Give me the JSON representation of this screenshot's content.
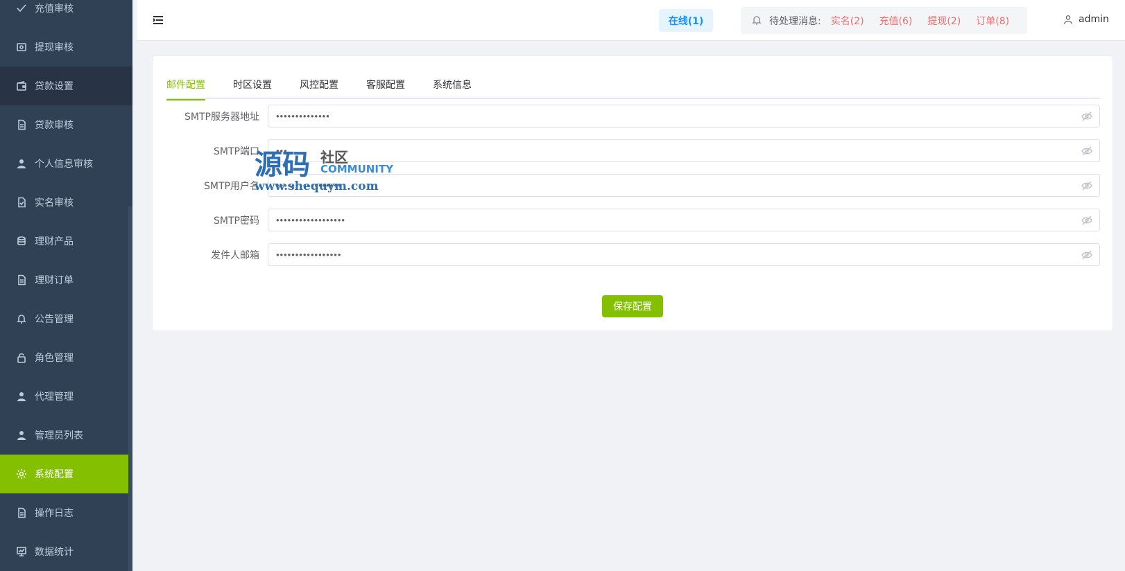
{
  "sidebar": {
    "items": [
      {
        "label": "充值审核",
        "icon": "check-icon"
      },
      {
        "label": "提现审核",
        "icon": "image-icon"
      },
      {
        "label": "贷款设置",
        "icon": "wallet-icon"
      },
      {
        "label": "贷款审核",
        "icon": "document-icon"
      },
      {
        "label": "个人信息审核",
        "icon": "user-icon"
      },
      {
        "label": "实名审核",
        "icon": "document-check-icon"
      },
      {
        "label": "理财产品",
        "icon": "coins-icon"
      },
      {
        "label": "理财订单",
        "icon": "document-icon"
      },
      {
        "label": "公告管理",
        "icon": "bell-icon"
      },
      {
        "label": "角色管理",
        "icon": "lock-icon"
      },
      {
        "label": "代理管理",
        "icon": "user-icon"
      },
      {
        "label": "管理员列表",
        "icon": "user-icon"
      },
      {
        "label": "系统配置",
        "icon": "gear-icon"
      },
      {
        "label": "操作日志",
        "icon": "document-icon"
      },
      {
        "label": "数据统计",
        "icon": "chart-icon"
      }
    ],
    "active_index": 12
  },
  "header": {
    "online": "在线(1)",
    "pending_label": "待处理消息:",
    "pending": [
      {
        "label": "实名(2)"
      },
      {
        "label": "充值(6)"
      },
      {
        "label": "提现(2)"
      },
      {
        "label": "订单(8)"
      }
    ],
    "username": "admin"
  },
  "tabs": [
    {
      "label": "邮件配置"
    },
    {
      "label": "时区设置"
    },
    {
      "label": "风控配置"
    },
    {
      "label": "客服配置"
    },
    {
      "label": "系统信息"
    }
  ],
  "form": {
    "fields": [
      {
        "label": "SMTP服务器地址",
        "value": "••••••••••••••"
      },
      {
        "label": "SMTP端口",
        "value": "•••"
      },
      {
        "label": "SMTP用户名",
        "value": "•••••••••••••••••"
      },
      {
        "label": "SMTP密码",
        "value": "••••••••••••••••••"
      },
      {
        "label": "发件人邮箱",
        "value": "•••••••••••••••••"
      }
    ],
    "save_label": "保存配置"
  },
  "watermark": {
    "main": "源码",
    "sub": "社区",
    "en": "COMMUNITY",
    "url": "www.shequym.com"
  },
  "colors": {
    "accent": "#84bf02",
    "sidebar_bg": "#304156",
    "alert": "#f56c6c",
    "online": "#1890ff"
  }
}
